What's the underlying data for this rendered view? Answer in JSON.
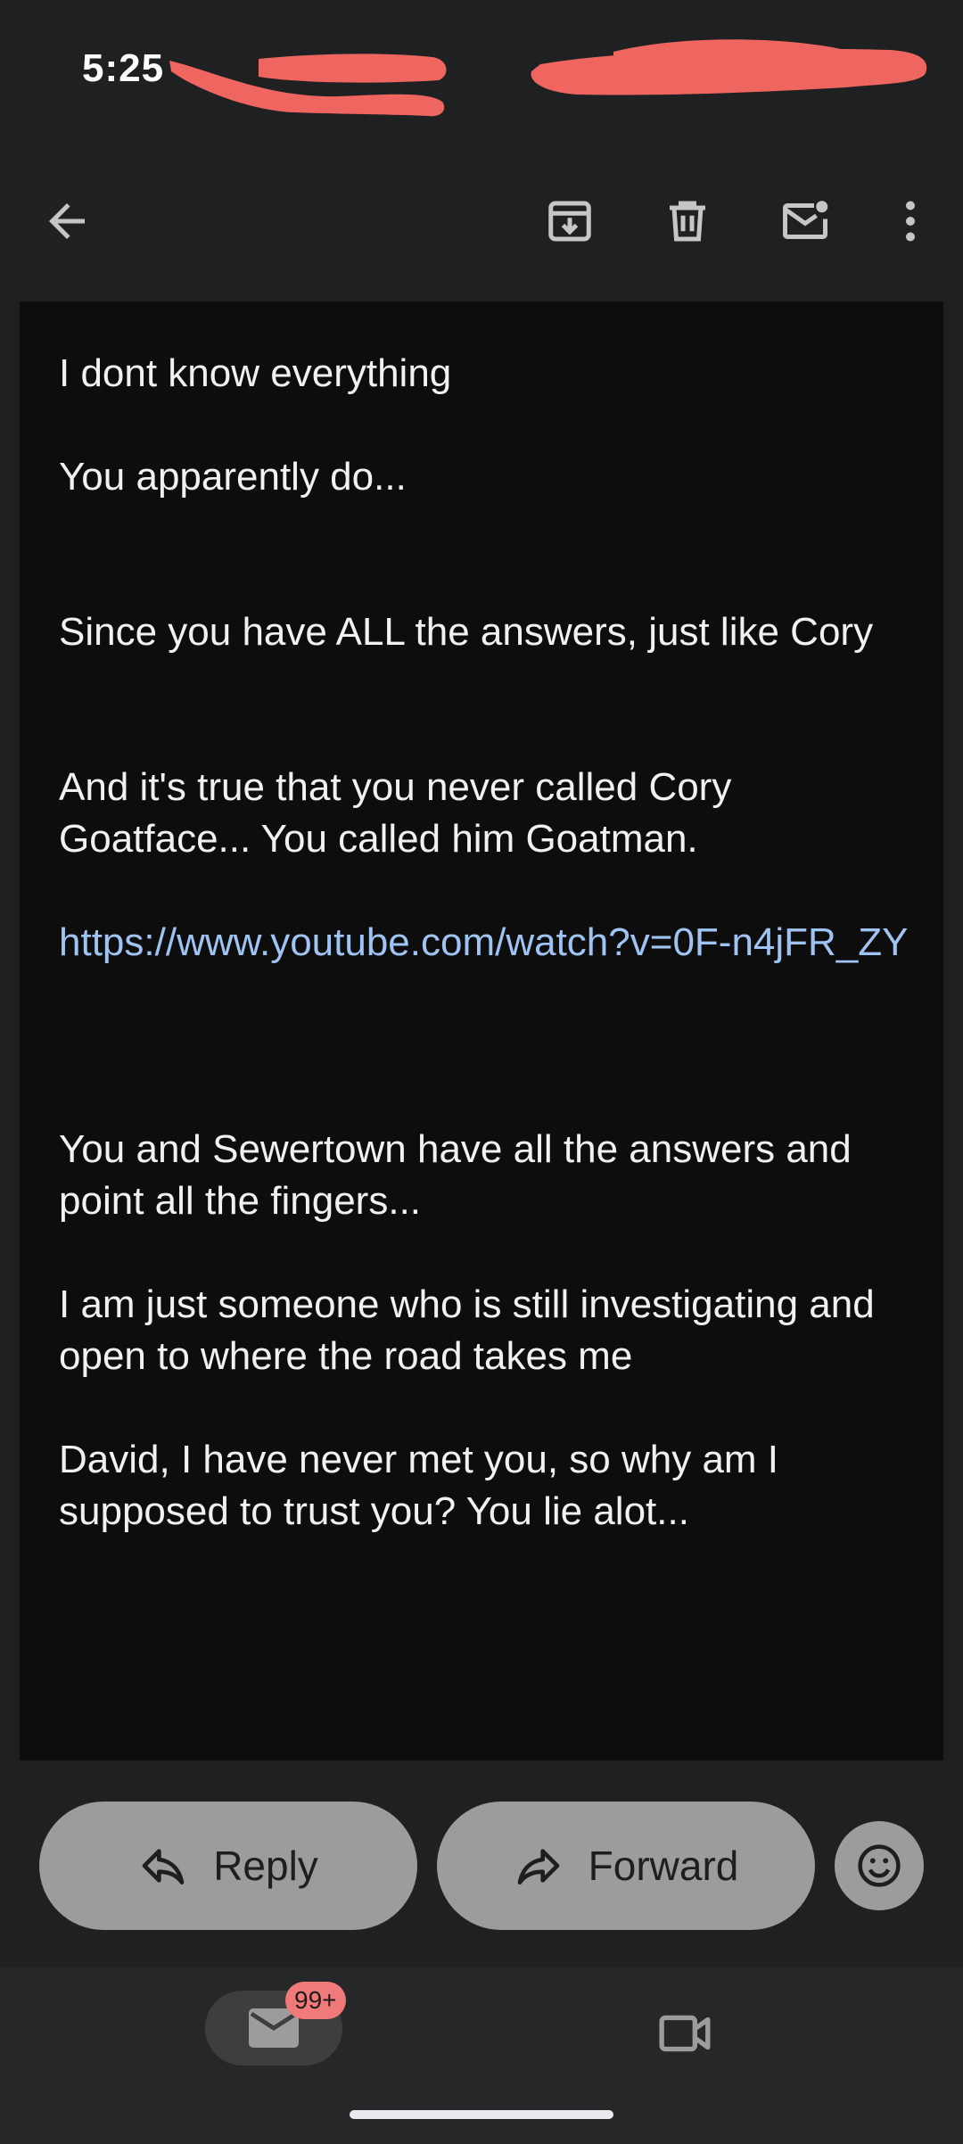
{
  "status_bar": {
    "time": "5:25"
  },
  "toolbar": {
    "back_icon": "arrow-left-icon",
    "archive_icon": "archive-icon",
    "delete_icon": "trash-icon",
    "mark_unread_icon": "mail-unread-icon",
    "more_icon": "more-vertical-icon"
  },
  "email": {
    "paragraphs": [
      "I dont know everything",
      "You apparently do...",
      "Since you have ALL the answers, just like Cory",
      "And it's true that you never called Cory Goatface... You called him Goatman.",
      "You and Sewertown have all the answers and point all the fingers...",
      "I am just someone who is still investigating and open to where the road takes me",
      "David, I have never met you, so why am I supposed to trust you? You lie alot..."
    ],
    "link": "https://www.youtube.com/watch?v=0F-n4jFR_ZY"
  },
  "actions": {
    "reply_label": "Reply",
    "forward_label": "Forward",
    "emoji_icon": "emoji-reaction-icon"
  },
  "bottom_nav": {
    "mail_badge": "99+",
    "mail_icon": "mail-icon",
    "meet_icon": "video-camera-icon"
  },
  "colors": {
    "background": "#1f2021",
    "body_background": "#0d0d0d",
    "link": "#9fc3f2",
    "pill": "#9c9d9a",
    "badge": "#f0797a",
    "redaction": "#ef6660"
  }
}
